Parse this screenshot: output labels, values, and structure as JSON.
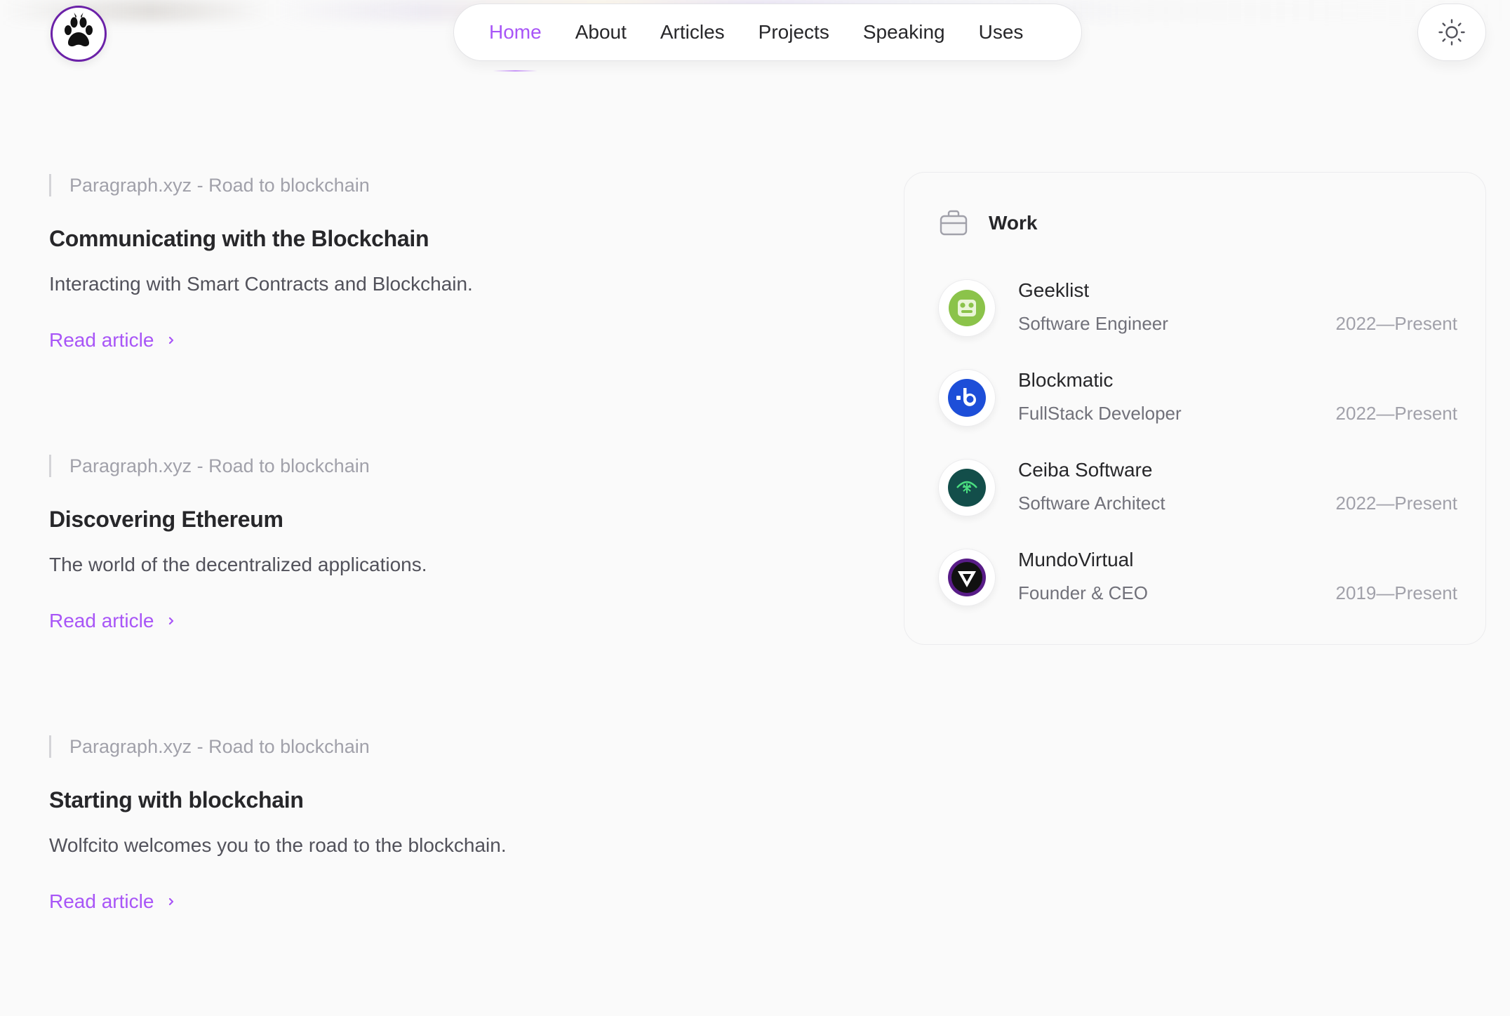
{
  "header": {
    "nav": [
      {
        "label": "Home",
        "active": true
      },
      {
        "label": "About",
        "active": false
      },
      {
        "label": "Articles",
        "active": false
      },
      {
        "label": "Projects",
        "active": false
      },
      {
        "label": "Speaking",
        "active": false
      },
      {
        "label": "Uses",
        "active": false
      }
    ],
    "logo_icon": "paw-icon",
    "theme_icon": "sun-icon"
  },
  "articles": [
    {
      "source": "Paragraph.xyz - Road to blockchain",
      "title": "Communicating with the Blockchain",
      "description": "Interacting with Smart Contracts and Blockchain.",
      "link": "Read article"
    },
    {
      "source": "Paragraph.xyz - Road to blockchain",
      "title": "Discovering Ethereum",
      "description": "The world of the decentralized applications.",
      "link": "Read article"
    },
    {
      "source": "Paragraph.xyz - Road to blockchain",
      "title": "Starting with blockchain",
      "description": "Wolfcito welcomes you to the road to the blockchain.",
      "link": "Read article"
    }
  ],
  "work": {
    "title": "Work",
    "icon": "briefcase-icon",
    "jobs": [
      {
        "company": "Geeklist",
        "role": "Software Engineer",
        "dates": "2022—Present",
        "logo": "geeklist-logo"
      },
      {
        "company": "Blockmatic",
        "role": "FullStack Developer",
        "dates": "2022—Present",
        "logo": "blockmatic-logo"
      },
      {
        "company": "Ceiba Software",
        "role": "Software Architect",
        "dates": "2022—Present",
        "logo": "ceiba-logo"
      },
      {
        "company": "MundoVirtual",
        "role": "Founder & CEO",
        "dates": "2019—Present",
        "logo": "mundovirtual-logo"
      }
    ]
  },
  "colors": {
    "accent": "#a855f7",
    "background": "#fafafa",
    "text": "#27272a",
    "muted": "#a1a1aa"
  }
}
